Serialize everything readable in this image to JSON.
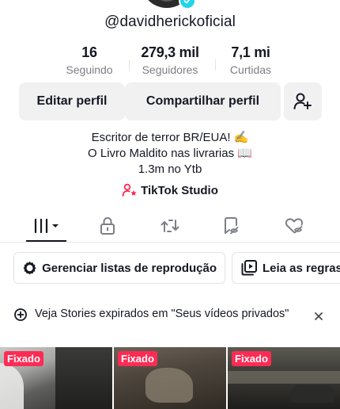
{
  "profile": {
    "username": "@davidherickoficial",
    "stats": [
      {
        "value": "16",
        "label": "Seguindo"
      },
      {
        "value": "279,3 mil",
        "label": "Seguidores"
      },
      {
        "value": "7,1 mi",
        "label": "Curtidas"
      }
    ],
    "bio_lines": [
      "Escritor de terror BR/EUA! ✍️",
      "O Livro Maldito nas livrarias 📖",
      "1.3m no Ytb"
    ],
    "studio_label": "TikTok Studio"
  },
  "actions": {
    "edit_label": "Editar perfil",
    "share_label": "Compartilhar perfil"
  },
  "tabs": [
    {
      "icon": "grid-icon",
      "active": true
    },
    {
      "icon": "lock-icon",
      "active": false
    },
    {
      "icon": "repost-icon",
      "active": false
    },
    {
      "icon": "favorites-icon",
      "active": false
    },
    {
      "icon": "liked-icon",
      "active": false
    }
  ],
  "chips": {
    "playlists_label": "Gerenciar listas de reprodução",
    "rules_label": "Leia as regras"
  },
  "banner": {
    "text": "Veja Stories expirados em \"Seus vídeos privados\""
  },
  "videos": [
    {
      "badge": "Fixado"
    },
    {
      "badge": "Fixado"
    },
    {
      "badge": "Fixado"
    }
  ],
  "colors": {
    "accent": "#fe2c55",
    "verified": "#20d5ec",
    "button_bg": "#f1f1f2",
    "muted_text": "#7d7e85"
  }
}
